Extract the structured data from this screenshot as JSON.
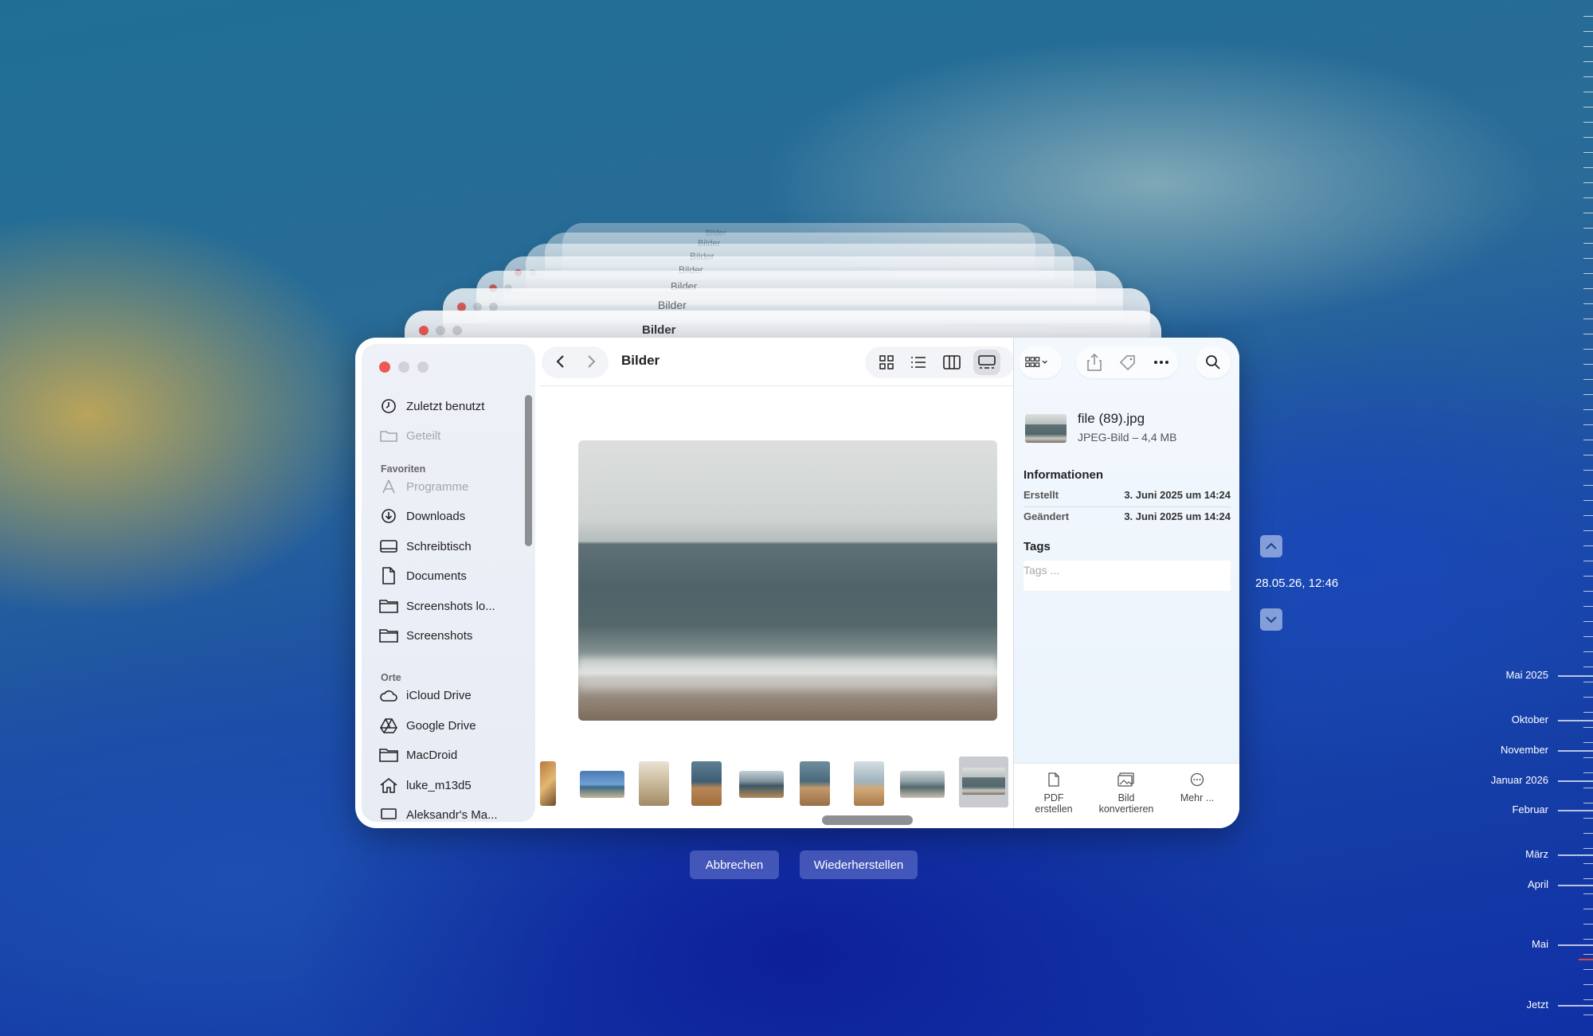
{
  "window": {
    "title": "Bilder",
    "ghost_title": "Bilder"
  },
  "sidebar": {
    "items_top": [
      {
        "label": "Zuletzt benutzt",
        "icon": "clock-icon",
        "dim": false
      },
      {
        "label": "Geteilt",
        "icon": "shared-folder-icon",
        "dim": true
      }
    ],
    "favorites_header": "Favoriten",
    "favorites": [
      {
        "label": "Programme",
        "icon": "apps-icon",
        "dim": true
      },
      {
        "label": "Downloads",
        "icon": "download-icon",
        "dim": false
      },
      {
        "label": "Schreibtisch",
        "icon": "desktop-icon",
        "dim": false
      },
      {
        "label": "Documents",
        "icon": "document-icon",
        "dim": false
      },
      {
        "label": "Screenshots lo...",
        "icon": "folder-icon",
        "dim": false
      },
      {
        "label": "Screenshots",
        "icon": "folder-icon",
        "dim": false
      }
    ],
    "places_header": "Orte",
    "places": [
      {
        "label": "iCloud Drive",
        "icon": "cloud-icon"
      },
      {
        "label": "Google Drive",
        "icon": "drive-icon"
      },
      {
        "label": "MacDroid",
        "icon": "folder-icon"
      },
      {
        "label": "luke_m13d5",
        "icon": "home-icon"
      },
      {
        "label": "Aleksandr's Ma...",
        "icon": "laptop-icon"
      }
    ]
  },
  "inspector": {
    "file_name": "file (89).jpg",
    "file_meta": "JPEG-Bild – 4,4 MB",
    "info_header": "Informationen",
    "rows": [
      {
        "key": "Erstellt",
        "value": "3. Juni 2025 um 14:24"
      },
      {
        "key": "Geändert",
        "value": "3. Juni 2025 um 14:24"
      }
    ],
    "tags_header": "Tags",
    "tags_placeholder": "Tags ...",
    "actions": [
      {
        "line1": "PDF",
        "line2": "erstellen"
      },
      {
        "line1": "Bild",
        "line2": "konvertieren"
      },
      {
        "line1": "Mehr ...",
        "line2": ""
      }
    ]
  },
  "buttons": {
    "cancel": "Abbrechen",
    "restore": "Wiederherstellen"
  },
  "timemachine": {
    "current_time": "28.05.26, 12:46",
    "timeline": [
      "Mai 2025",
      "Oktober",
      "November",
      "Januar 2026",
      "Februar",
      "März",
      "April",
      "Mai",
      "Jetzt"
    ]
  }
}
